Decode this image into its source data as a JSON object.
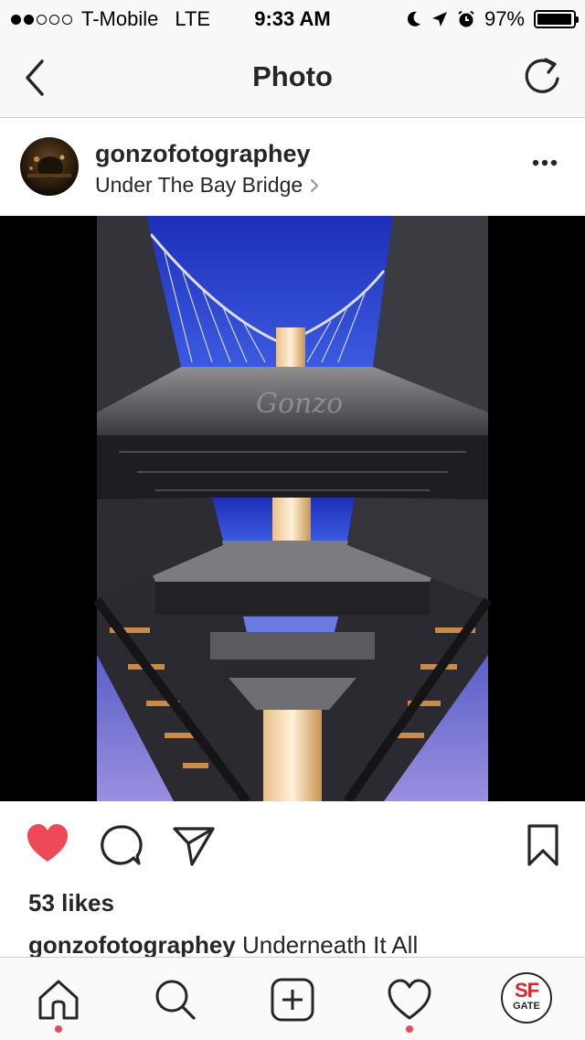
{
  "status_bar": {
    "signal_dots_filled": 2,
    "signal_dots_total": 5,
    "carrier": "T-Mobile",
    "network": "LTE",
    "time": "9:33 AM",
    "battery": "97%",
    "battery_level": 0.97
  },
  "nav": {
    "title": "Photo",
    "back_icon": "chevron-left-icon",
    "refresh_icon": "refresh-icon"
  },
  "post": {
    "username": "gonzofotographey",
    "location": "Under The Bay Bridge",
    "more_icon": "more-horizontal-icon",
    "photo_watermark": "Gonzo",
    "likes": "53 likes",
    "caption_user": "gonzofotographey",
    "caption_text": "Underneath It All",
    "liked": true,
    "like_color": "#ed4956"
  },
  "tab_bar": {
    "items": [
      "home-icon",
      "search-icon",
      "add-post-icon",
      "activity-heart-icon",
      "profile-avatar"
    ],
    "profile_sf": "SF",
    "profile_gate": "GATE",
    "notification_color": "#ed4956"
  }
}
